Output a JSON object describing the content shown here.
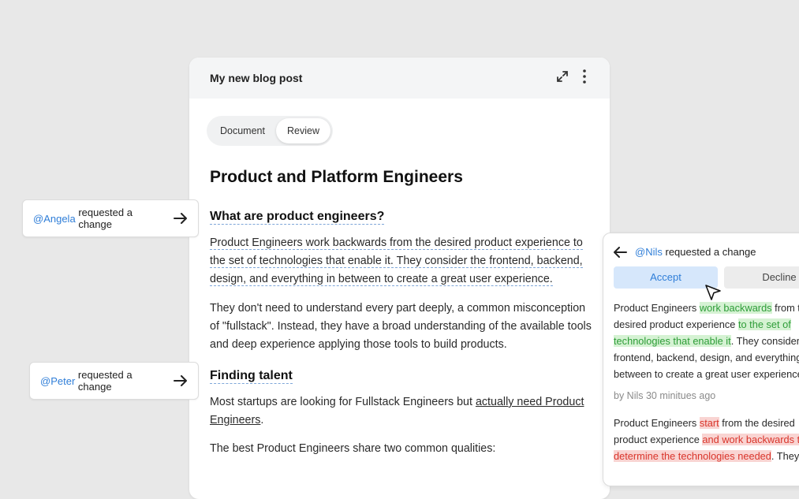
{
  "card": {
    "title": "My new blog post",
    "tabs": [
      "Document",
      "Review"
    ],
    "active_tab": "Review"
  },
  "doc": {
    "h1": "Product and Platform Engineers",
    "section1_title": "What are product engineers?",
    "p1": "Product Engineers work backwards from the desired product experience to the set of technologies that enable it. They consider the frontend, backend, design, and everything in between to create a great user experience.",
    "p2": "They don't need to understand every part deeply, a common misconception of \"fullstack\". Instead, they have a broad understanding of the available tools and deep experience applying those tools to build products.",
    "section2_title": "Finding talent",
    "p3_a": "Most startups are looking for Fullstack Engineers but ",
    "p3_link": "actually need Product Engineers",
    "p3_b": ".",
    "p4": "The best Product Engineers share two common qualities:"
  },
  "pills": {
    "angela_mention": "@Angela",
    "peter_mention": "@Peter",
    "text": "requested a change"
  },
  "review": {
    "mention": "@Nils",
    "text": "requested a change",
    "accept": "Accept",
    "decline": "Decline",
    "d1_a": "Product Engineers ",
    "d1_add1": "work backwards",
    "d1_b": " from the",
    "d1_c": "desired product experience ",
    "d1_add2": "to the set of",
    "d1_add3": "technologies that enable it",
    "d1_d": ". They consider the",
    "d1_e": "frontend, backend, design, and everything in",
    "d1_f": "between to create a great user experience.",
    "meta": "by Nils 30 minitues ago",
    "d2_a": "Product Engineers ",
    "d2_del1": "start",
    "d2_b": " from the desired",
    "d2_c": "product experience ",
    "d2_del2": "and work backwards to",
    "d2_del3": "determine the technologies needed",
    "d2_d": ". They"
  },
  "colors": {
    "accent": "#2f7ed8",
    "added": "#2e9d38",
    "removed": "#d9352b"
  }
}
